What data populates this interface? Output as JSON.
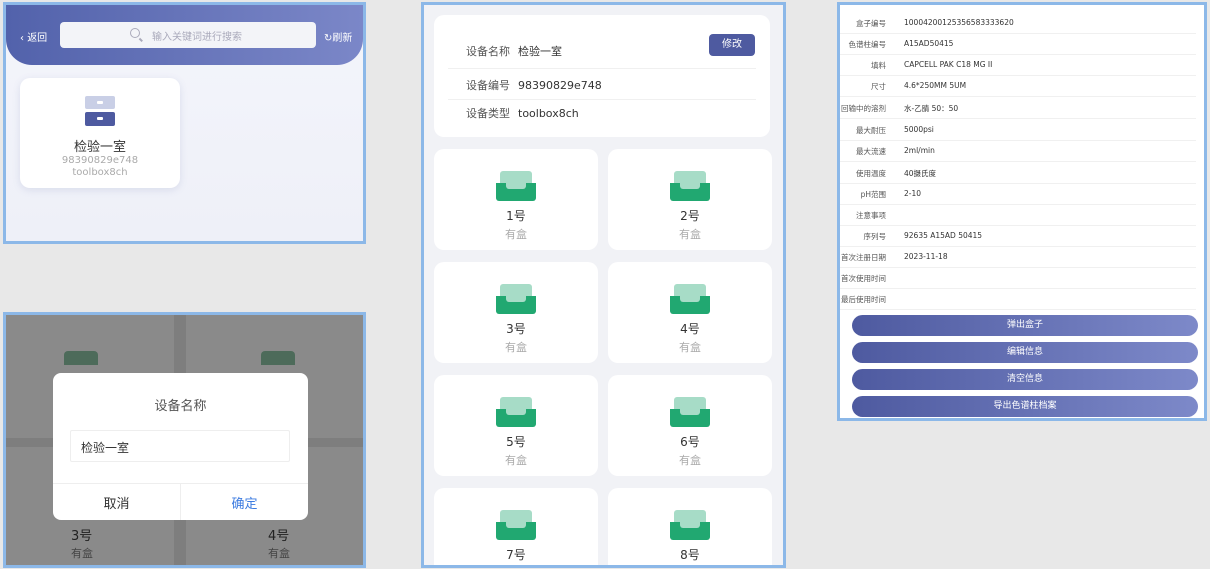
{
  "list_screen": {
    "back_label": "返回",
    "search_placeholder": "输入关键词进行搜索",
    "refresh_label": "刷新",
    "device_card": {
      "name": "检验一室",
      "id": "98390829e748",
      "type": "toolbox8ch"
    }
  },
  "edit_dialog": {
    "title": "设备名称",
    "value": "检验一室",
    "cancel_label": "取消",
    "confirm_label": "确定",
    "background_boxes": [
      {
        "label": "3号",
        "status": "有盒"
      },
      {
        "label": "4号",
        "status": "有盒"
      }
    ]
  },
  "device_detail": {
    "rows": [
      {
        "label": "设备名称",
        "value": "检验一室"
      },
      {
        "label": "设备编号",
        "value": "98390829e748"
      },
      {
        "label": "设备类型",
        "value": "toolbox8ch"
      }
    ],
    "edit_label": "修改",
    "boxes": [
      {
        "label": "1号",
        "status": "有盒"
      },
      {
        "label": "2号",
        "status": "有盒"
      },
      {
        "label": "3号",
        "status": "有盒"
      },
      {
        "label": "4号",
        "status": "有盒"
      },
      {
        "label": "5号",
        "status": "有盒"
      },
      {
        "label": "6号",
        "status": "有盒"
      },
      {
        "label": "7号",
        "status": ""
      },
      {
        "label": "8号",
        "status": ""
      }
    ]
  },
  "box_detail": {
    "fields": [
      {
        "label": "盒子编号",
        "value": "10004200125356583333620"
      },
      {
        "label": "色谱柱编号",
        "value": "A15AD50415"
      },
      {
        "label": "填料",
        "value": "CAPCELL PAK C18 MG II"
      },
      {
        "label": "尺寸",
        "value": "4.6*250MM 5UM"
      },
      {
        "label": "回输中的溶剂",
        "value": "水-乙腈 50：50"
      },
      {
        "label": "最大耐压",
        "value": "5000psi"
      },
      {
        "label": "最大流速",
        "value": "2ml/min"
      },
      {
        "label": "使用温度",
        "value": "40摄氏度"
      },
      {
        "label": "pH范围",
        "value": "2-10"
      },
      {
        "label": "注意事项",
        "value": ""
      },
      {
        "label": "序列号",
        "value": "92635 A15AD 50415"
      },
      {
        "label": "首次注册日期",
        "value": "2023-11-18"
      },
      {
        "label": "首次使用时间",
        "value": ""
      },
      {
        "label": "最后使用时间",
        "value": ""
      }
    ],
    "buttons": [
      "弹出盒子",
      "编辑信息",
      "清空信息",
      "导出色谱柱档案"
    ]
  },
  "colors": {
    "primary": "#4e5aa0",
    "tray_green": "#21a871",
    "tray_light": "#a7dcc7",
    "panel_border": "#8cb8e8",
    "confirm_blue": "#3c7be0"
  }
}
